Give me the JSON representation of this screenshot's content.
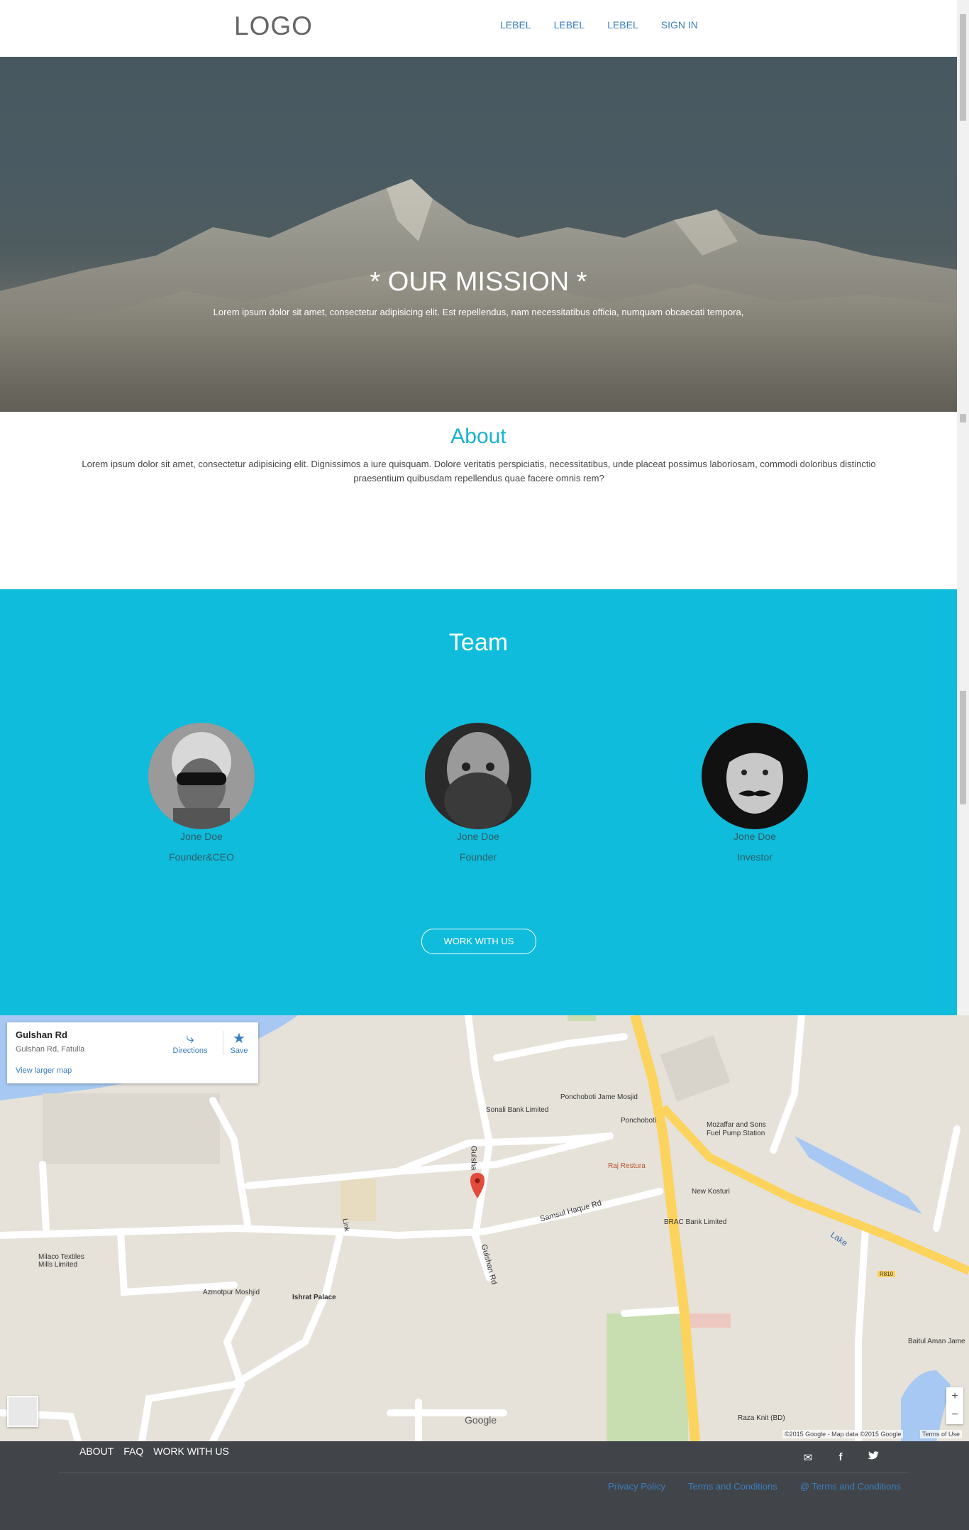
{
  "nav": {
    "logo": "LOGO",
    "links": [
      "LEBEL",
      "LEBEL",
      "LEBEL",
      "SIGN IN"
    ]
  },
  "hero": {
    "title": "* OUR MISSION *",
    "subtitle": "Lorem ipsum dolor sit amet, consectetur adipisicing elit. Est repellendus, nam necessitatibus officia, numquam obcaecati tempora,"
  },
  "about": {
    "heading": "About",
    "text": "Lorem ipsum dolor sit amet, consectetur adipisicing elit. Dignissimos a iure quisquam. Dolore veritatis perspiciatis, necessitatibus, unde placeat possimus laboriosam, commodi doloribus distinctio praesentium quibusdam repellendus quae facere omnis rem?"
  },
  "team": {
    "heading": "Team",
    "members": [
      {
        "name": "Jone Doe",
        "role": "Founder&CEO"
      },
      {
        "name": "Jone Doe",
        "role": "Founder"
      },
      {
        "name": "Jone Doe",
        "role": "Investor"
      }
    ],
    "button": "WORK WITH US"
  },
  "map": {
    "place_title": "Gulshan Rd",
    "place_subtitle": "Gulshan Rd, Fatulla",
    "larger_map": "View larger map",
    "directions": "Directions",
    "save": "Save",
    "labels": {
      "ponchoboti_mosjid": "Ponchoboti Jame Mosjid",
      "sonali_bank": "Sonali Bank Limited",
      "ponchoboti": "Ponchoboti",
      "mozaffar": "Mozaffar and Sons",
      "fuel_pump": "Fuel Pump Station",
      "raj_restura": "Raj Restura",
      "new_kosturi": "New Kosturi",
      "brac_bank": "BRAC Bank Limited",
      "milaco": "Milaco Textiles",
      "mills_limited": "Mills Limited",
      "azmotpur": "Azmotpur Moshjid",
      "ishrat": "Ishrat Palace",
      "samsul": "Samsul Haque Rd",
      "gulshan_rd": "Gulshan Rd",
      "gulshan_short": "Gulsha",
      "link": "Link",
      "lake": "Lake",
      "r810": "R810",
      "baitul": "Baitul Aman Jame",
      "raza_knit": "Raza Knit (BD)",
      "google": "Google"
    },
    "attribution": "©2015 Google - Map data ©2015 Google",
    "terms": "Terms of Use",
    "zoom_in": "+",
    "zoom_out": "−"
  },
  "footer": {
    "links": [
      "ABOUT",
      "FAQ",
      "WORK WITH US"
    ],
    "legal": [
      "Privacy Policy",
      "Terms and Conditions",
      "@ Terms and Conditions"
    ],
    "icons": [
      "mail-icon",
      "facebook-icon",
      "twitter-icon"
    ]
  },
  "colors": {
    "accent": "#1ab3cf",
    "team_bg": "#0fbcdb",
    "footer_bg": "#414448",
    "link": "#3a7fc1"
  }
}
